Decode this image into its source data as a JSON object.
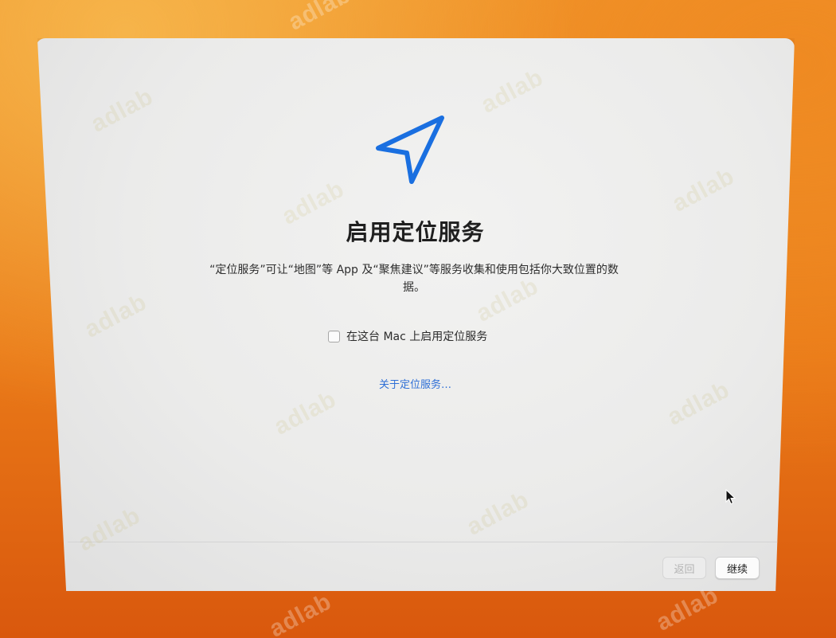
{
  "setup": {
    "icon": "location-arrow-icon",
    "title": "启用定位服务",
    "description": "“定位服务”可让“地图”等 App 及“聚焦建议”等服务收集和使用包括你大致位置的数据。",
    "checkbox": {
      "label": "在这台 Mac 上启用定位服务",
      "checked": false
    },
    "about_link": "关于定位服务…",
    "buttons": {
      "back": "返回",
      "continue": "继续"
    }
  },
  "watermark": "adlab",
  "colors": {
    "accent": "#1a6fe0",
    "link": "#2f6fd6",
    "background_orange": "#ea7a18"
  }
}
